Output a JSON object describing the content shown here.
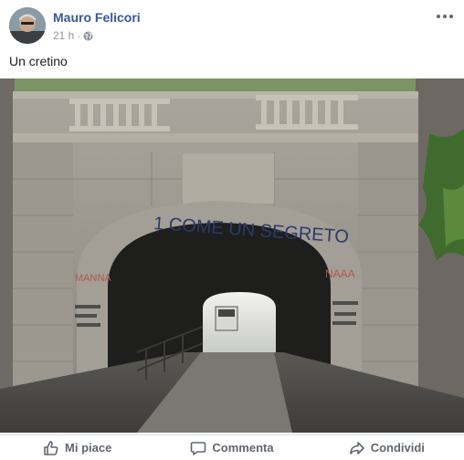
{
  "post": {
    "author": "Mauro Felicori",
    "time": "21 h",
    "separator": "·",
    "privacy_icon": "globe-icon",
    "more_icon": "more-dots-icon",
    "text": "Un cretino"
  },
  "photo": {
    "graffiti_main": "1 COME UN SEGRETO",
    "graffiti_right": "NAAA",
    "graffiti_left": "MANNA"
  },
  "actions": {
    "like_label": "Mi piace",
    "comment_label": "Commenta",
    "share_label": "Condividi",
    "like_icon": "thumbs-up-icon",
    "comment_icon": "comment-bubble-icon",
    "share_icon": "share-arrow-icon"
  },
  "colors": {
    "author_name": "#385898",
    "action_text": "#606770",
    "meta_text": "#90949c"
  }
}
